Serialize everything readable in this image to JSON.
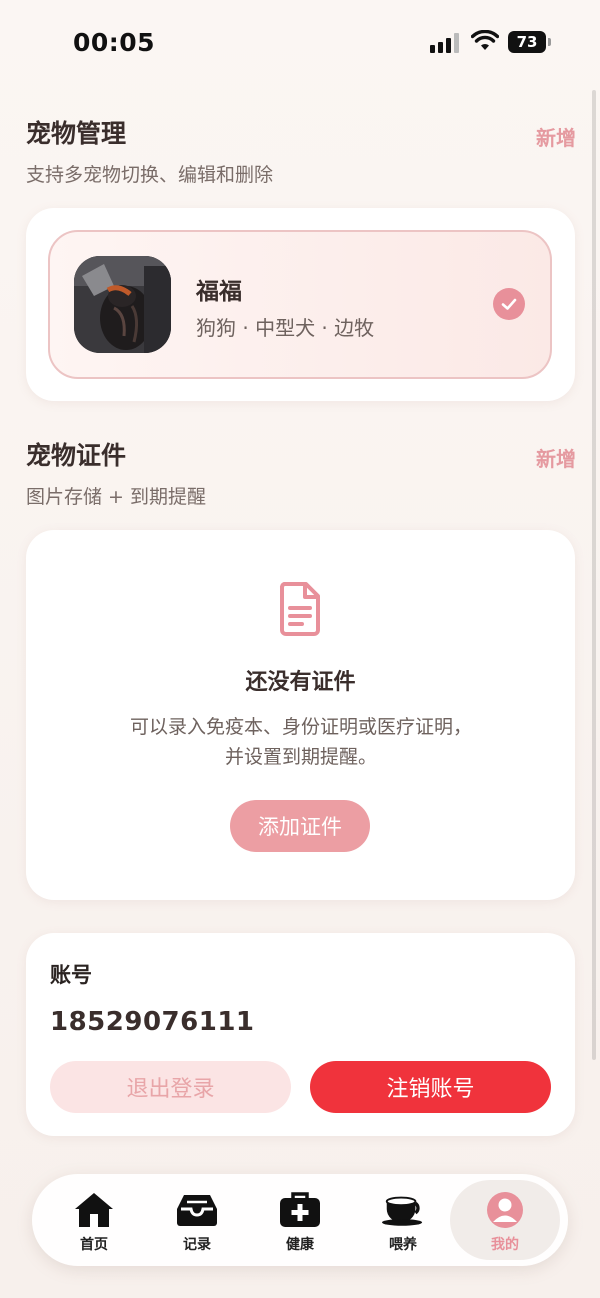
{
  "status_bar": {
    "time": "00:05",
    "battery": "73"
  },
  "pet_section": {
    "title": "宠物管理",
    "subtitle": "支持多宠物切换、编辑和删除",
    "add_label": "新增",
    "pets": [
      {
        "name": "福福",
        "description": "狗狗 · 中型犬 · 边牧",
        "selected": true
      }
    ]
  },
  "cert_section": {
    "title": "宠物证件",
    "subtitle": "图片存储 + 到期提醒",
    "add_label": "新增",
    "empty_title": "还没有证件",
    "empty_desc_line1": "可以录入免疫本、身份证明或医疗证明，",
    "empty_desc_line2": "并设置到期提醒。",
    "add_button": "添加证件"
  },
  "account": {
    "label": "账号",
    "phone": "18529076111",
    "logout_button": "退出登录",
    "delete_button": "注销账号"
  },
  "tabbar": {
    "tabs": [
      {
        "label": "首页",
        "icon": "home-icon"
      },
      {
        "label": "记录",
        "icon": "inbox-tray-icon"
      },
      {
        "label": "健康",
        "icon": "medical-kit-icon"
      },
      {
        "label": "喂养",
        "icon": "bowl-icon"
      },
      {
        "label": "我的",
        "icon": "user-icon",
        "active": true
      }
    ]
  },
  "colors": {
    "accent": "#e8909a",
    "danger": "#f0333c",
    "background": "#f8f2ee"
  }
}
